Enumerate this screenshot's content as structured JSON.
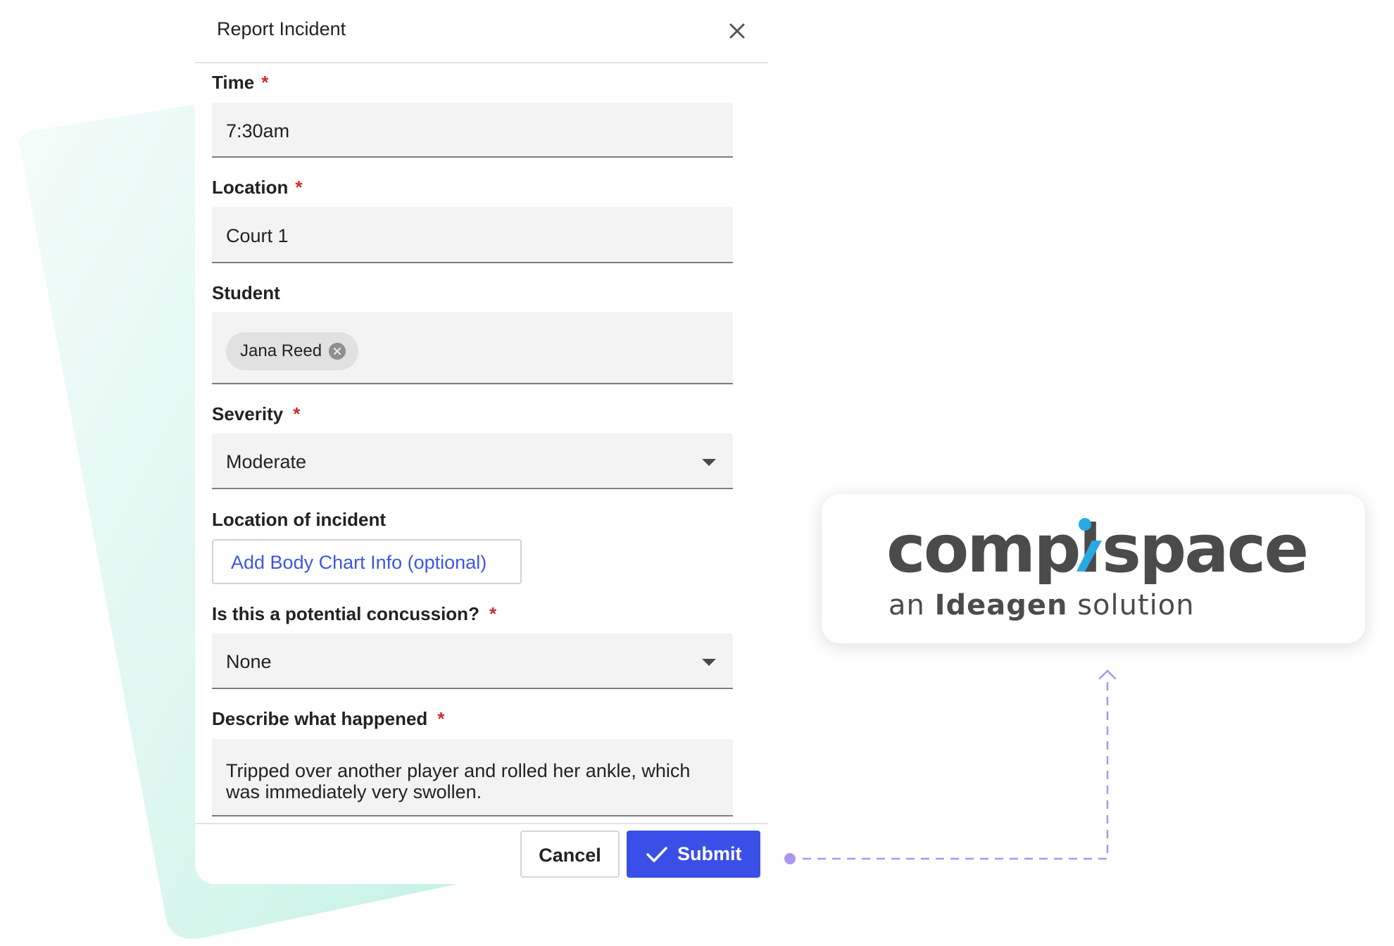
{
  "modal": {
    "title": "Report Incident",
    "close_icon": "close-icon"
  },
  "fields": {
    "time": {
      "label": "Time",
      "required_mark": "*",
      "value": "7:30am"
    },
    "location": {
      "label": "Location",
      "required_mark": "*",
      "value": "Court 1"
    },
    "student": {
      "label": "Student",
      "chip_label": "Jana Reed",
      "chip_remove_icon": "remove-chip-icon"
    },
    "severity": {
      "label": "Severity",
      "required_mark": "*",
      "value": "Moderate"
    },
    "location_of_incident": {
      "label": "Location of incident",
      "button_label": "Add Body Chart Info (optional)"
    },
    "concussion": {
      "label": "Is this a potential concussion?",
      "required_mark": "*",
      "value": "None"
    },
    "describe": {
      "label": "Describe what happened",
      "required_mark": "*",
      "value_line1": "Tripped over another player and rolled her ankle, which",
      "value_line2": "was immediately very swollen."
    }
  },
  "actions": {
    "cancel_label": "Cancel",
    "submit_label": "Submit",
    "submit_icon": "check-icon"
  },
  "logo": {
    "wordmark_left": "compl",
    "wordmark_right": "space",
    "tagline_prefix": "an",
    "tagline_brand": "Ideagen",
    "tagline_suffix": "solution"
  },
  "colors": {
    "accent_blue": "#3a4fe8",
    "link_blue": "#3f55e6",
    "required_red": "#d02a2a",
    "logo_gray": "#4b4b4b",
    "logo_accent": "#29a9e1",
    "connector_purple": "#a896f0",
    "backdrop_mint": "#d9f7ef"
  }
}
